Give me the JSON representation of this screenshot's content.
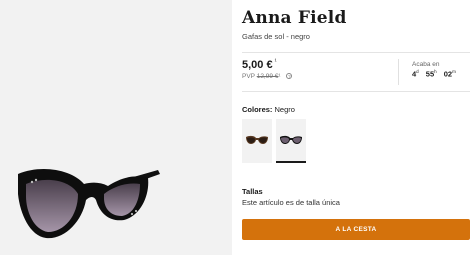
{
  "product": {
    "brand": "Anna Field",
    "name": "Gafas de sol - negro"
  },
  "pricing": {
    "price": "5,00 €",
    "price_sup": "¹",
    "pvp_label": "PVP",
    "pvp_old": "12,99 €",
    "pvp_sup": "¹",
    "info_symbol": "?",
    "ends_label": "Acaba en",
    "timer": {
      "days": "4",
      "days_unit": "d",
      "hours": "55",
      "hours_unit": "h",
      "minutes": "02",
      "minutes_unit": "m"
    }
  },
  "colors": {
    "label": "Colores:",
    "selected": "Negro",
    "swatches": [
      "tortoise",
      "black"
    ]
  },
  "sizes": {
    "label": "Tallas",
    "text": "Este artículo es de talla única"
  },
  "cta": {
    "label": "A LA CESTA",
    "color": "#d4720c"
  }
}
